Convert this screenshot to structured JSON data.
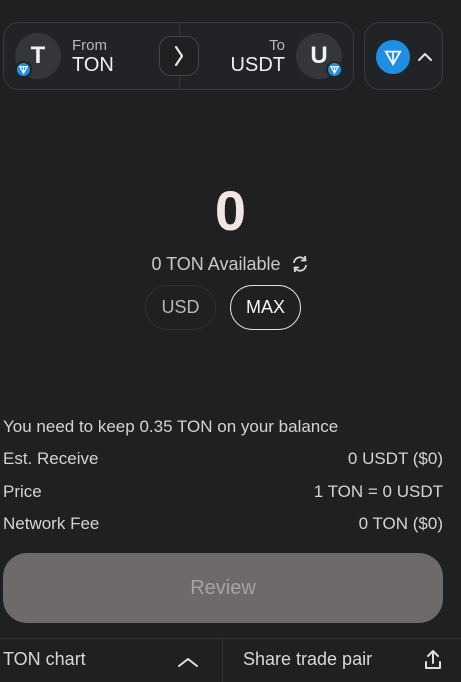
{
  "swap": {
    "from_label": "From",
    "from_token": "TON",
    "from_badge": "T",
    "to_label": "To",
    "to_token": "USDT",
    "to_badge": "U"
  },
  "network": {
    "icon": "ton-diamond-icon"
  },
  "amount": "0",
  "available": "0 TON Available",
  "currency_buttons": {
    "usd": "USD",
    "max": "MAX"
  },
  "notice": "You need to keep 0.35 TON on your balance",
  "details": [
    {
      "label": "Est. Receive",
      "value": "0 USDT ($0)"
    },
    {
      "label": "Price",
      "value": "1 TON = 0 USDT"
    },
    {
      "label": "Network Fee",
      "value": "0 TON ($0)"
    }
  ],
  "review_label": "Review",
  "bottom": {
    "chart_label": "TON chart",
    "share_label": "Share trade pair"
  },
  "colors": {
    "background": "#1f2022",
    "accent": "#1f8fe5",
    "review_bg": "#6d6a69"
  }
}
